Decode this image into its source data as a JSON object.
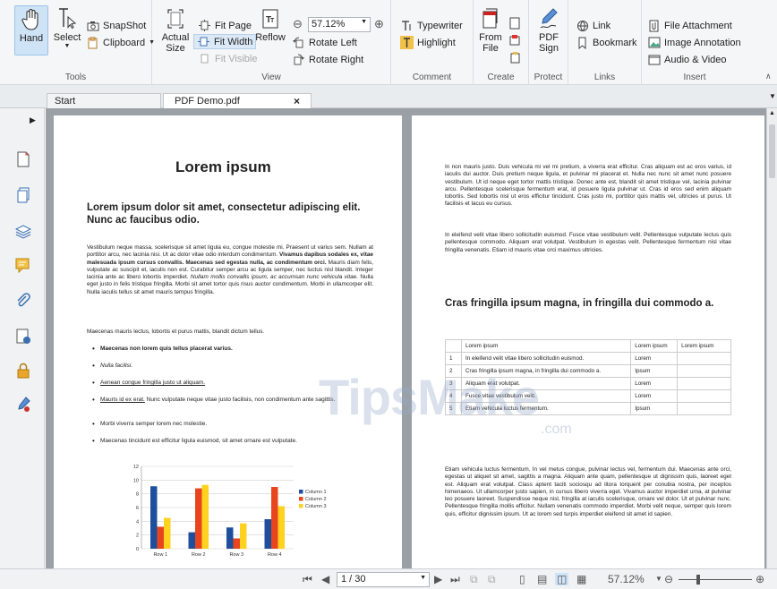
{
  "ribbon": {
    "tools": {
      "label": "Tools",
      "hand": "Hand",
      "select": "Select",
      "snapshot": "SnapShot",
      "clipboard": "Clipboard"
    },
    "view": {
      "label": "View",
      "actual_size_1": "Actual",
      "actual_size_2": "Size",
      "fit_page": "Fit Page",
      "fit_width": "Fit Width",
      "fit_visible": "Fit Visible",
      "reflow": "Reflow",
      "zoom_value": "57.12%",
      "rotate_left": "Rotate Left",
      "rotate_right": "Rotate Right"
    },
    "comment": {
      "label": "Comment",
      "typewriter": "Typewriter",
      "highlight": "Highlight"
    },
    "create": {
      "label": "Create",
      "from_file_1": "From",
      "from_file_2": "File"
    },
    "protect": {
      "label": "Protect",
      "pdf_sign_1": "PDF",
      "pdf_sign_2": "Sign"
    },
    "links": {
      "label": "Links",
      "link": "Link",
      "bookmark": "Bookmark"
    },
    "insert": {
      "label": "Insert",
      "file_attachment": "File Attachment",
      "image_annotation": "Image Annotation",
      "audio_video": "Audio & Video"
    }
  },
  "tabs": [
    {
      "label": "Start"
    },
    {
      "label": "PDF Demo.pdf"
    }
  ],
  "page1": {
    "title": "Lorem ipsum",
    "subtitle": "Lorem ipsum dolor sit amet, consectetur adipiscing elit. Nunc ac faucibus odio.",
    "para1a": "Vestibulum neque massa, scelerisque sit amet ligula eu, congue molestie mi. Praesent ut varius sem. Nullam at porttitor arcu, nec lacinia nisi. Ut ac dolor vitae odio interdum condimentum.",
    "para1b": "Vivamus dapibus sodales ex, vitae malesuada ipsum cursus convallis. Maecenas sed egestas nulla, ac condimentum orci.",
    "para1c": "Mauris diam felis, vulputate ac suscipit et, iaculis non est. Curabitur semper arcu ac ligula semper, nec luctus nisl blandit. Integer lacinia ante ac libero lobortis imperdiet.",
    "para1d": "Nullam mollis convallis ipsum, ac accumsan nunc vehicula vitae.",
    "para1e": "Nulla eget justo in felis tristique fringilla. Morbi sit amet tortor quis risus auctor condimentum. Morbi in ullamcorper elit. Nulla iaculis tellus sit amet mauris tempus fringilla.",
    "para2": "Maecenas mauris lectus, lobortis et purus mattis, blandit dictum tellus.",
    "bullets": [
      "Maecenas non lorem quis tellus placerat varius.",
      "Nulla facilisi.",
      "Aenean congue fringilla justo ut aliquam.",
      "Mauris id ex erat.",
      "Nunc vulputate neque vitae justo facilisis, non condimentum ante sagittis.",
      "Morbi viverra semper lorem nec molestie.",
      "Maecenas tincidunt est efficitur ligula euismod, sit amet ornare est vulputate."
    ]
  },
  "chart_data": {
    "type": "bar",
    "categories": [
      "Row 1",
      "Row 2",
      "Row 3",
      "Row 4"
    ],
    "series": [
      {
        "name": "Column 1",
        "values": [
          9.1,
          2.4,
          3.1,
          4.3
        ],
        "color": "#1f4e9c"
      },
      {
        "name": "Column 2",
        "values": [
          3.2,
          8.8,
          1.5,
          9.0
        ],
        "color": "#e8451e"
      },
      {
        "name": "Column 3",
        "values": [
          4.5,
          9.3,
          3.7,
          6.2
        ],
        "color": "#ffd21f"
      }
    ],
    "ylim": [
      0,
      12
    ],
    "yticks": [
      "0",
      "2",
      "4",
      "6",
      "8",
      "10",
      "12"
    ],
    "grid": true,
    "legend": "right"
  },
  "page2": {
    "para1": "In non mauris justo. Duis vehicula mi vel mi pretium, a viverra erat efficitur. Cras aliquam est ac eros varius, id iaculis dui auctor. Duis pretium neque ligula, et pulvinar mi placerat et. Nulla nec nunc sit amet nunc posuere vestibulum. Ut id neque eget tortor mattis tristique. Donec ante est, blandit sit amet tristique vel, lacinia pulvinar arcu. Pellentesque scelerisque fermentum erat, id posuere ligula pulvinar ut. Cras id eros sed enim aliquam lobortis. Sed lobortis nisl ut eros efficitur tincidunt. Cras justo mi, porttitor quis mattis vel, ultricies ut purus. Ut facilisis et lacus eu cursus.",
    "para2": "In eleifend velit vitae libero sollicitudin euismod. Fusce vitae vestibulum velit. Pellentesque vulputate lectus quis pellentesque commodo. Aliquam erat volutpat. Vestibulum in egestas velit. Pellentesque fermentum nisl vitae fringilla venenatis. Etiam id mauris vitae orci maximus ultricies.",
    "heading": "Cras fringilla ipsum magna, in fringilla dui commodo a.",
    "table_header": [
      "",
      "Lorem ipsum",
      "Lorem ipsum",
      "Lorem ipsum"
    ],
    "table_rows": [
      [
        "1",
        "In eleifend velit vitae libero sollicitudin euismod.",
        "Lorem",
        ""
      ],
      [
        "2",
        "Cras fringilla ipsum magna, in fringilla dui commodo a.",
        "Ipsum",
        ""
      ],
      [
        "3",
        "Aliquam erat volutpat.",
        "Lorem",
        ""
      ],
      [
        "4",
        "Fusce vitae vestibulum velit.",
        "Lorem",
        ""
      ],
      [
        "5",
        "Etiam vehicula luctus fermentum.",
        "Ipsum",
        ""
      ]
    ],
    "para3": "Etiam vehicula luctus fermentum. In vel metus congue, pulvinar lectus vel, fermentum dui. Maecenas ante orci, egestas ut aliquet sit amet, sagittis a magna. Aliquam ante quam, pellentesque ut dignissim quis, laoreet eget est. Aliquam erat volutpat. Class aptent taciti sociosqu ad litora torquent per conubia nostra, per inceptos himenaeos. Ut ullamcorper justo sapien, in cursus libero viverra eget. Vivamus auctor imperdiet urna, at pulvinar leo posuere laoreet. Suspendisse neque nisl, fringilla at iaculis scelerisque, ornare vel dolor. Ut et pulvinar nunc. Pellentesque fringilla mollis efficitur. Nullam venenatis commodo imperdiet. Morbi velit neque, semper quis lorem quis, efficitur dignissim ipsum. Ut ac lorem sed turpis imperdiet eleifend sit amet id sapien."
  },
  "watermark": {
    "main": "TipsMake",
    "suffix": ".com"
  },
  "statusbar": {
    "page_indicator": "1 / 30",
    "zoom": "57.12%"
  }
}
